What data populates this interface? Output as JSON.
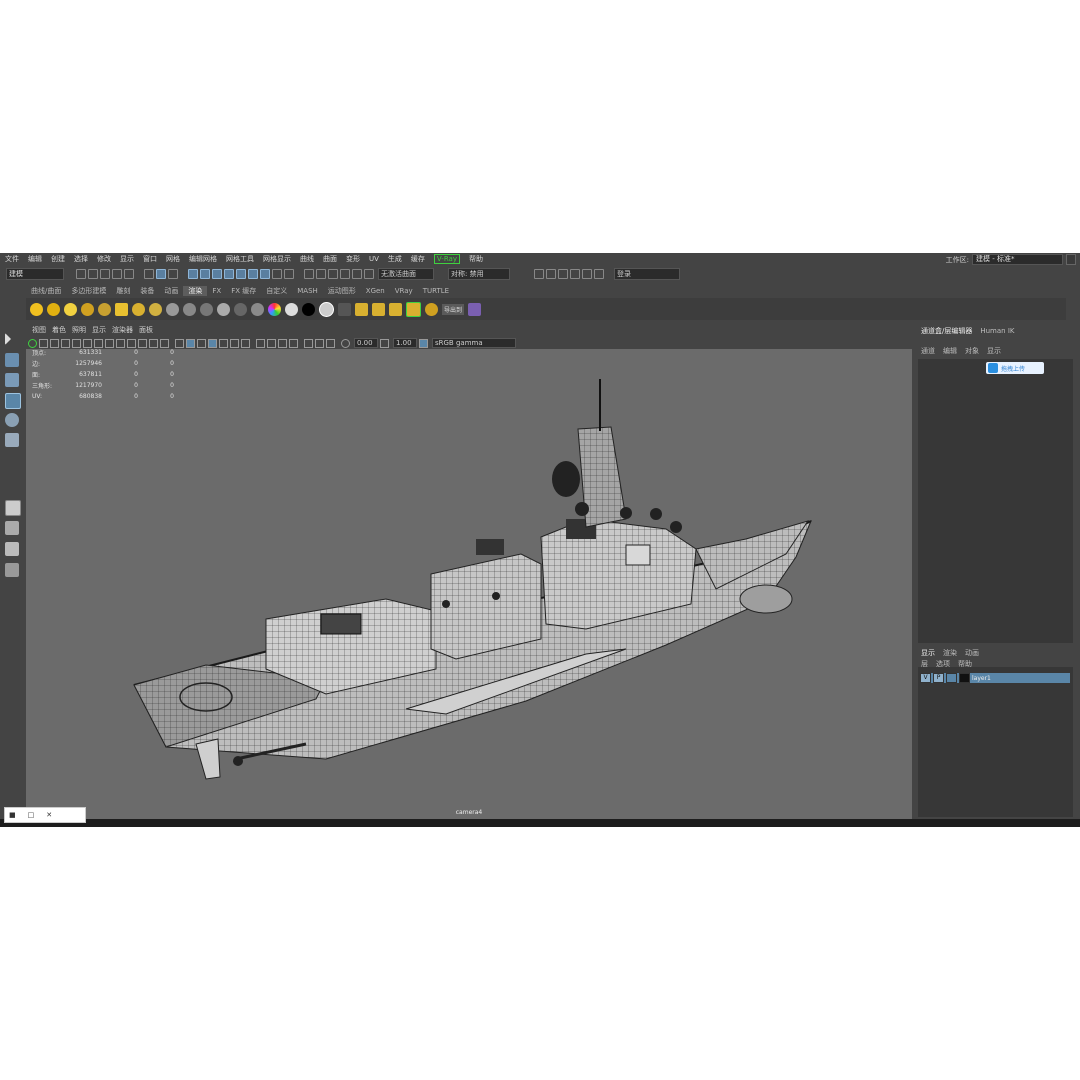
{
  "menu": [
    "文件",
    "编辑",
    "创建",
    "选择",
    "修改",
    "显示",
    "窗口",
    "网格",
    "编辑网格",
    "网格工具",
    "网格显示",
    "曲线",
    "曲面",
    "变形",
    "UV",
    "生成",
    "缓存",
    "V-Ray",
    "帮助"
  ],
  "workspace": {
    "label": "工作区:",
    "value": "建模 - 标准*"
  },
  "status": {
    "mode": "建模",
    "no_live": "无激活曲面",
    "symmetry": "对称: 禁用",
    "login": "登录"
  },
  "shelf_tabs": [
    "曲线/曲面",
    "多边形建模",
    "雕刻",
    "装备",
    "动画",
    "渲染",
    "FX",
    "FX 缓存",
    "自定义",
    "MASH",
    "运动图形",
    "XGen",
    "VRay",
    "TURTLE"
  ],
  "shelf_active": "渲染",
  "shelf_label": "导出到",
  "panel_menu": [
    "视图",
    "着色",
    "照明",
    "显示",
    "渲染器",
    "面板"
  ],
  "panel_tools": {
    "exposure": "0.00",
    "gamma": "1.00",
    "colorspace": "sRGB gamma"
  },
  "hud": [
    {
      "k": "顶点:",
      "v": "631331",
      "a": "0",
      "b": "0"
    },
    {
      "k": "边:",
      "v": "1257946",
      "a": "0",
      "b": "0"
    },
    {
      "k": "面:",
      "v": "637811",
      "a": "0",
      "b": "0"
    },
    {
      "k": "三角形:",
      "v": "1217970",
      "a": "0",
      "b": "0"
    },
    {
      "k": "UV:",
      "v": "680838",
      "a": "0",
      "b": "0"
    }
  ],
  "camera": "camera4",
  "right_panel": {
    "tabs": [
      "通道盒/层编辑器",
      "Human IK"
    ],
    "menu": [
      "通道",
      "编辑",
      "对象",
      "显示"
    ],
    "upload": "拖拽上传",
    "layer_tabs": [
      "显示",
      "渲染",
      "动画"
    ],
    "layer_menu": [
      "层",
      "选项",
      "帮助"
    ],
    "layer": {
      "v": "V",
      "p": "P",
      "name": "layer1"
    }
  },
  "colors": {
    "bg": "#444444",
    "viewport": "#6b6b6b",
    "accent": "#5a86a8",
    "vray": "#3fd13f"
  }
}
